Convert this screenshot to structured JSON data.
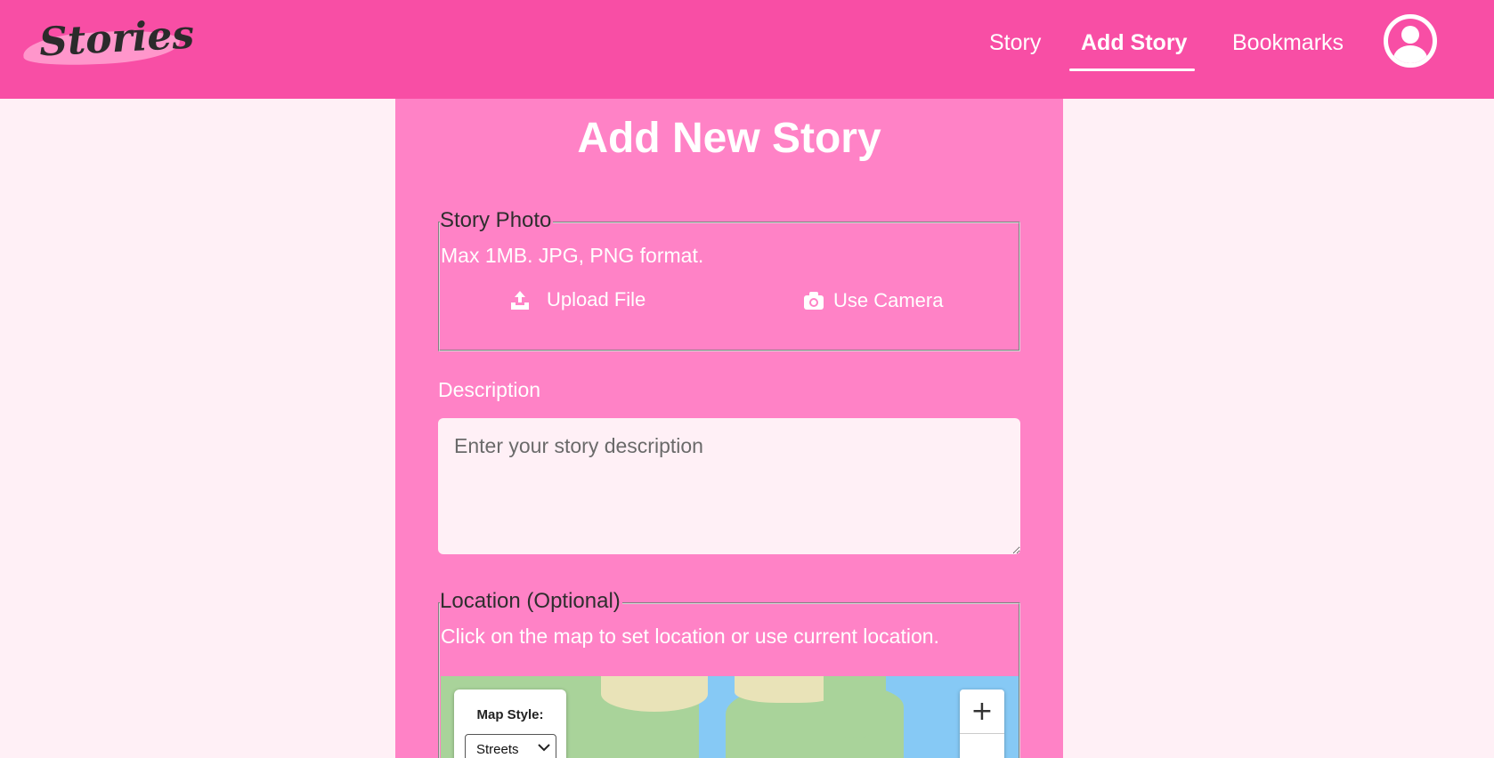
{
  "header": {
    "logo_text": "Stories",
    "nav": [
      {
        "label": "Story"
      },
      {
        "label": "Add Story"
      },
      {
        "label": "Bookmarks"
      }
    ],
    "active_nav": "Add Story"
  },
  "form": {
    "title": "Add New Story",
    "photo": {
      "legend": "Story Photo",
      "hint": "Max 1MB. JPG, PNG format.",
      "upload_label": "Upload File",
      "camera_label": "Use Camera"
    },
    "description": {
      "label": "Description",
      "placeholder": "Enter your story description",
      "value": ""
    },
    "location": {
      "legend": "Location (Optional)",
      "hint": "Click on the map to set location or use current location.",
      "map_style_label": "Map Style:",
      "map_style_value": "Streets",
      "zoom_in_label": "+"
    }
  },
  "colors": {
    "header_bg": "#f84ea5",
    "card_bg": "#ff82c6",
    "page_bg": "#fff0f6"
  },
  "icons": [
    "user-avatar-icon",
    "upload-icon",
    "camera-icon",
    "chevron-down-icon"
  ]
}
